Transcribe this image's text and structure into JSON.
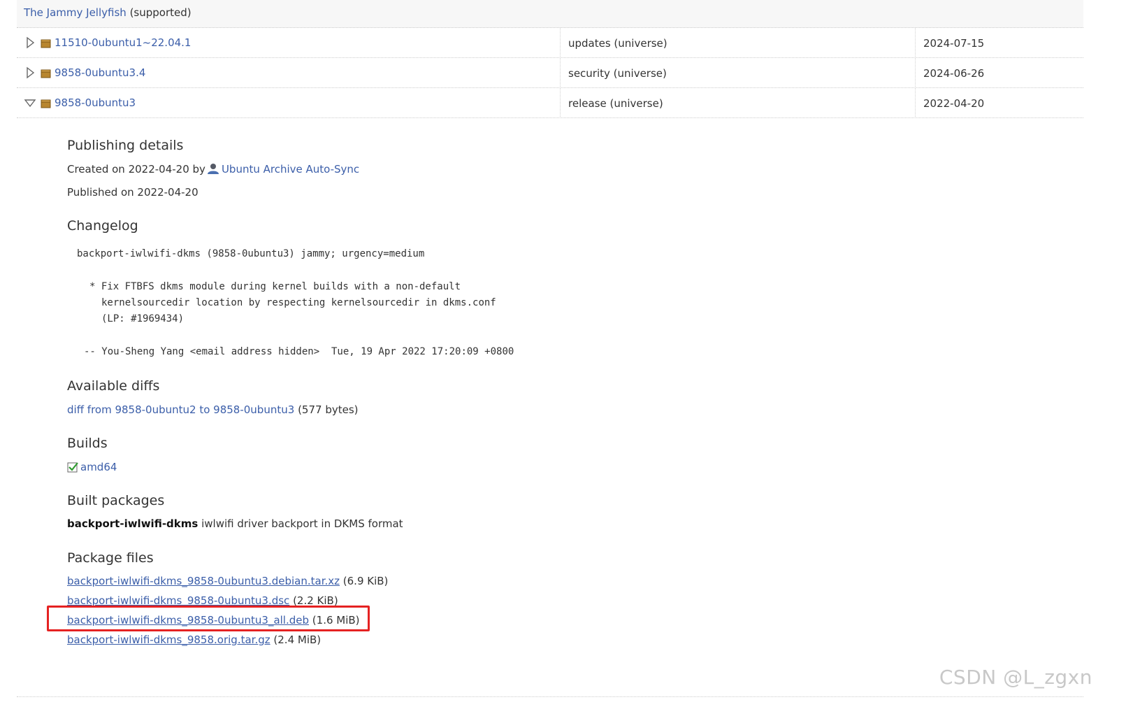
{
  "series": {
    "name": "The Jammy Jellyfish",
    "status": "(supported)"
  },
  "publications": [
    {
      "version": "11510-0ubuntu1~22.04.1",
      "pocket": "updates (universe)",
      "date": "2024-07-15",
      "expanded": false
    },
    {
      "version": "9858-0ubuntu3.4",
      "pocket": "security (universe)",
      "date": "2024-06-26",
      "expanded": false
    },
    {
      "version": "9858-0ubuntu3",
      "pocket": "release (universe)",
      "date": "2022-04-20",
      "expanded": true
    }
  ],
  "publishing_details": {
    "heading": "Publishing details",
    "created_prefix": "Created on 2022-04-20 by",
    "creator": "Ubuntu Archive Auto-Sync",
    "published": "Published on 2022-04-20"
  },
  "changelog": {
    "heading": "Changelog",
    "line1": "backport-iwlwifi-dkms (9858-0ubuntu3) jammy; urgency=medium",
    "line2": "* Fix FTBFS dkms module during kernel builds with a non-default",
    "line3": "kernelsourcedir location by respecting kernelsourcedir in dkms.conf",
    "line4_prefix": "(LP: ",
    "bug_link": "#1969434",
    "line4_suffix": ")",
    "signoff": "-- You-Sheng Yang <email address hidden>  Tue, 19 Apr 2022 17:20:09 +0800"
  },
  "available_diffs": {
    "heading": "Available diffs",
    "link": "diff from 9858-0ubuntu2 to 9858-0ubuntu3",
    "size": "(577 bytes)"
  },
  "builds": {
    "heading": "Builds",
    "arch": "amd64"
  },
  "built_packages": {
    "heading": "Built packages",
    "name": "backport-iwlwifi-dkms",
    "description": "iwlwifi driver backport in DKMS format"
  },
  "package_files": {
    "heading": "Package files",
    "files": [
      {
        "name": "backport-iwlwifi-dkms_9858-0ubuntu3.debian.tar.xz",
        "size": "(6.9 KiB)"
      },
      {
        "name": "backport-iwlwifi-dkms_9858-0ubuntu3.dsc",
        "size": "(2.2 KiB)"
      },
      {
        "name": "backport-iwlwifi-dkms_9858-0ubuntu3_all.deb",
        "size": "(1.6 MiB)"
      },
      {
        "name": "backport-iwlwifi-dkms_9858.orig.tar.gz",
        "size": "(2.4 MiB)"
      }
    ]
  },
  "watermark": "CSDN @L_zgxn",
  "colors": {
    "link": "#3b5ea9",
    "highlight": "#e52222"
  }
}
